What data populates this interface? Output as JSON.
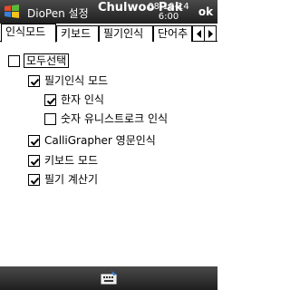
{
  "titlebar": {
    "app_title": "DioPen 설정",
    "owner": "Chulwoo Pak",
    "date": "08-10-14",
    "time": "6:00",
    "ok_label": "ok"
  },
  "tabs": [
    {
      "label": "인식모드",
      "active": true
    },
    {
      "label": "키보드",
      "active": false
    },
    {
      "label": "필기인식",
      "active": false
    },
    {
      "label": "단어추",
      "active": false
    }
  ],
  "options": {
    "select_all": {
      "label": "모두선택",
      "checked": false
    },
    "handwriting_mode": {
      "label": "필기인식 모드",
      "checked": true
    },
    "hanja": {
      "label": "한자 인식",
      "checked": true
    },
    "unistroke_numbers": {
      "label": "숫자 유니스트로크 인식",
      "checked": false
    },
    "calligrapher": {
      "label": "CalliGrapher 영문인식",
      "checked": true
    },
    "keyboard_mode": {
      "label": "키보드 모드",
      "checked": true
    },
    "handwriting_calc": {
      "label": "필기 계산기",
      "checked": true
    }
  },
  "icons": {
    "start": "windows-flag-icon",
    "sip": "input-panel-icon",
    "tab_left": "left-arrow-icon",
    "tab_right": "right-arrow-icon"
  }
}
